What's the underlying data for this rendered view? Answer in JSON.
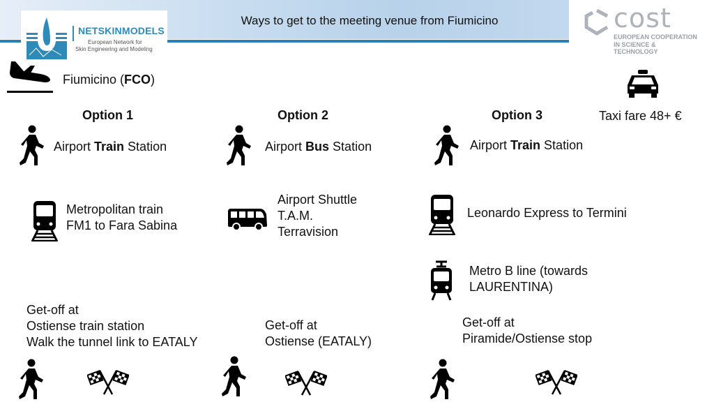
{
  "header": {
    "title": "Ways to get to the meeting venue from Fiumicino"
  },
  "logos": {
    "left": {
      "name": "NETSKINMODELS",
      "line1": "European Network for",
      "line2": "Skin Engineering and Modeling"
    },
    "right": {
      "name": "cost",
      "line1": "EUROPEAN COOPERATION",
      "line2": "IN SCIENCE & TECHNOLOGY"
    }
  },
  "origin": {
    "prefix": "Fiumicino (",
    "code": "FCO",
    "suffix": ")",
    "icon": "airplane-landing-icon"
  },
  "taxi": {
    "icon": "taxi-icon",
    "label": "Taxi fare 48+ €"
  },
  "options": [
    {
      "title": "Option 1",
      "step1": {
        "pre": "Airport ",
        "bold": "Train",
        "post": " Station",
        "icon": "walking-person-icon"
      },
      "step2": {
        "lines": [
          "Metropolitan train",
          "FM1 to Fara Sabina"
        ],
        "icon": "train-icon"
      },
      "final": {
        "lines": [
          "Get-off at",
          "Ostiense train station",
          "Walk the tunnel link to EATALY"
        ]
      },
      "end_icons": [
        "walking-person-icon",
        "checkered-flags-icon"
      ]
    },
    {
      "title": "Option 2",
      "step1": {
        "pre": "Airport ",
        "bold": "Bus",
        "post": " Station",
        "icon": "walking-person-icon"
      },
      "step2": {
        "lines": [
          "Airport Shuttle",
          "T.A.M.",
          "Terravision"
        ],
        "icon": "bus-icon"
      },
      "final": {
        "lines": [
          "Get-off at",
          "Ostiense (EATALY)"
        ]
      },
      "end_icons": [
        "walking-person-icon",
        "checkered-flags-icon"
      ]
    },
    {
      "title": "Option 3",
      "step1": {
        "pre": "Airport ",
        "bold": "Train",
        "post": " Station",
        "icon": "walking-person-icon"
      },
      "step2": {
        "lines": [
          "Leonardo Express to Termini"
        ],
        "icon": "train-icon"
      },
      "step3": {
        "lines": [
          "Metro B line (towards",
          "LAURENTINA)"
        ],
        "icon": "tram-icon"
      },
      "final": {
        "lines": [
          "Get-off at",
          "Piramide/Ostiense stop"
        ]
      },
      "end_icons": [
        "walking-person-icon",
        "checkered-flags-icon"
      ]
    }
  ]
}
